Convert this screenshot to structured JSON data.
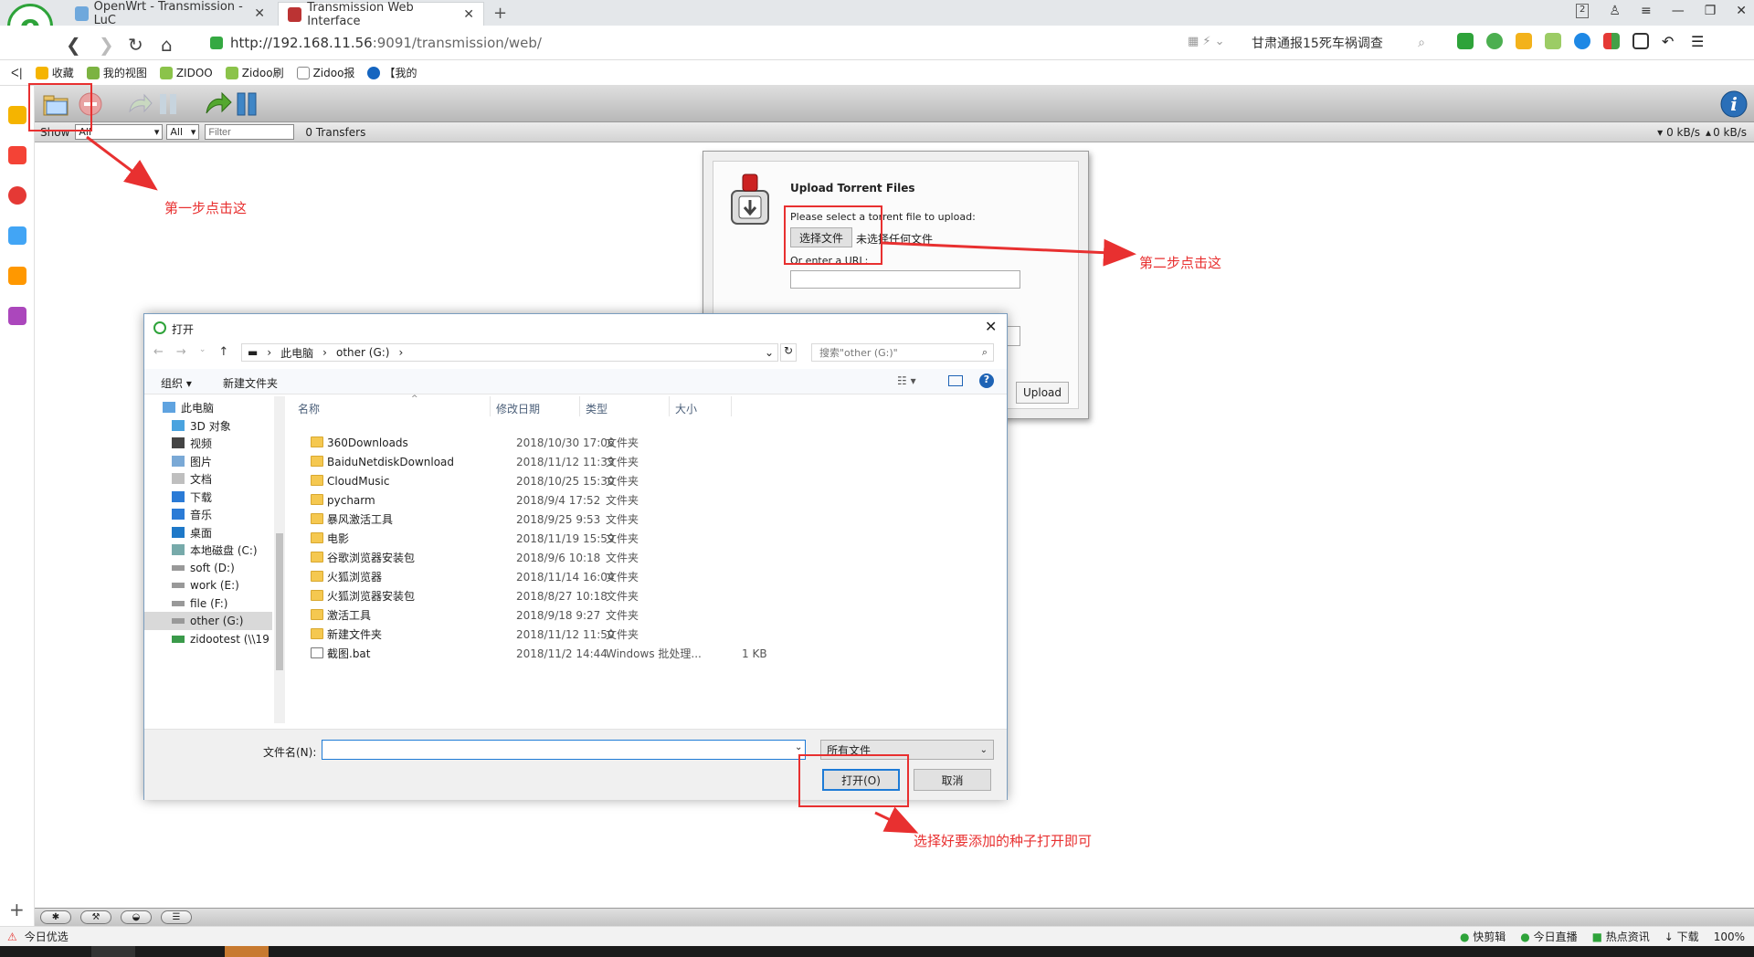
{
  "browser": {
    "logo_letter": "e",
    "tabs": [
      {
        "title": "OpenWrt - Transmission - LuC"
      },
      {
        "title": "Transmission Web Interface"
      }
    ],
    "new_tab": "+",
    "tab_count_badge": "2",
    "url_host": "http://192.168.11.56",
    "url_rest": ":9091/transmission/web/",
    "news_text": "甘肃通报15死车祸调查",
    "bookmarks": [
      "收藏",
      "我的视图",
      "ZIDOO",
      "Zidoo刷",
      "Zidoo报",
      "【我的"
    ],
    "colors": {
      "accent": "#2ea33a",
      "annotation_red": "#e83030"
    }
  },
  "transmission": {
    "show_label": "Show",
    "filter_state": "All",
    "filter_tracker": "All",
    "filter_placeholder": "Filter",
    "transfers": "0 Transfers",
    "down_speed": "0 kB/s",
    "up_speed": "0 kB/s"
  },
  "upload_dialog": {
    "title": "Upload Torrent Files",
    "select_prompt": "Please select a torrent file to upload:",
    "choose_button": "选择文件",
    "no_file": "未选择任何文件",
    "url_label": "Or enter a URL:",
    "upload_button": "Upload"
  },
  "file_dialog": {
    "title": "打开",
    "path": [
      "此电脑",
      "other (G:)"
    ],
    "search_placeholder": "搜索\"other (G:)\"",
    "organize": "组织",
    "new_folder": "新建文件夹",
    "columns": {
      "name": "名称",
      "date": "修改日期",
      "type": "类型",
      "size": "大小"
    },
    "tree": [
      "此电脑",
      "3D 对象",
      "视频",
      "图片",
      "文档",
      "下载",
      "音乐",
      "桌面",
      "本地磁盘 (C:)",
      "soft (D:)",
      "work (E:)",
      "file (F:)",
      "other (G:)",
      "zidootest (\\\\19"
    ],
    "files": [
      {
        "name": "360Downloads",
        "date": "2018/10/30 17:06",
        "type": "文件夹",
        "size": ""
      },
      {
        "name": "BaiduNetdiskDownload",
        "date": "2018/11/12 11:33",
        "type": "文件夹",
        "size": ""
      },
      {
        "name": "CloudMusic",
        "date": "2018/10/25 15:30",
        "type": "文件夹",
        "size": ""
      },
      {
        "name": "pycharm",
        "date": "2018/9/4 17:52",
        "type": "文件夹",
        "size": ""
      },
      {
        "name": "暴风激活工具",
        "date": "2018/9/25 9:53",
        "type": "文件夹",
        "size": ""
      },
      {
        "name": "电影",
        "date": "2018/11/19 15:59",
        "type": "文件夹",
        "size": ""
      },
      {
        "name": "谷歌浏览器安装包",
        "date": "2018/9/6 10:18",
        "type": "文件夹",
        "size": ""
      },
      {
        "name": "火狐浏览器",
        "date": "2018/11/14 16:04",
        "type": "文件夹",
        "size": ""
      },
      {
        "name": "火狐浏览器安装包",
        "date": "2018/8/27 10:18",
        "type": "文件夹",
        "size": ""
      },
      {
        "name": "激活工具",
        "date": "2018/9/18 9:27",
        "type": "文件夹",
        "size": ""
      },
      {
        "name": "新建文件夹",
        "date": "2018/11/12 11:50",
        "type": "文件夹",
        "size": ""
      },
      {
        "name": "截图.bat",
        "date": "2018/11/2 14:44",
        "type": "Windows 批处理...",
        "size": "1 KB"
      }
    ],
    "filename_label": "文件名(N):",
    "filetype": "所有文件",
    "open_button": "打开(O)",
    "cancel_button": "取消"
  },
  "annotations": {
    "step1": "第一步点击这",
    "step2": "第二步点击这",
    "step3": "选择好要添加的种子打开即可"
  },
  "statusbar": {
    "left": "今日优选",
    "items": [
      "快剪辑",
      "今日直播",
      "热点资讯",
      "下载",
      "100%"
    ]
  }
}
